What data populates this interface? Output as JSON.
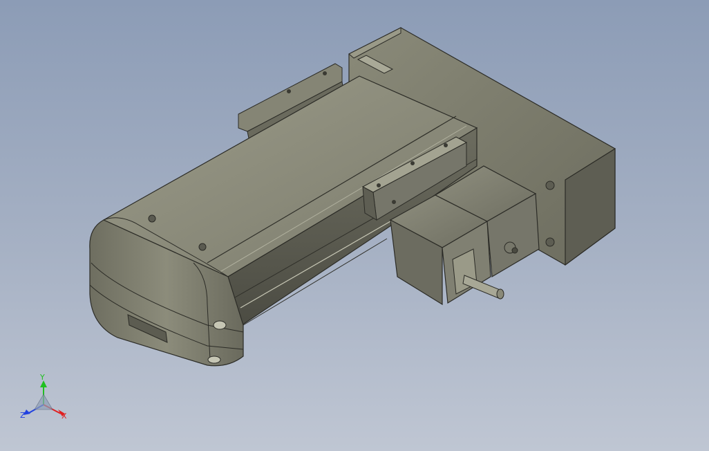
{
  "viewport": {
    "background_top": "#8c9cb6",
    "background_bottom": "#bfc6d3"
  },
  "model": {
    "body_color": "#7e7e6e",
    "body_dark": "#55554b",
    "body_light": "#a4a493",
    "motor_color": "#77776a"
  },
  "triad": {
    "x_label": "X",
    "y_label": "Y",
    "z_label": "Z",
    "x_color": "#e02020",
    "y_color": "#20c020",
    "z_color": "#2040e0"
  }
}
